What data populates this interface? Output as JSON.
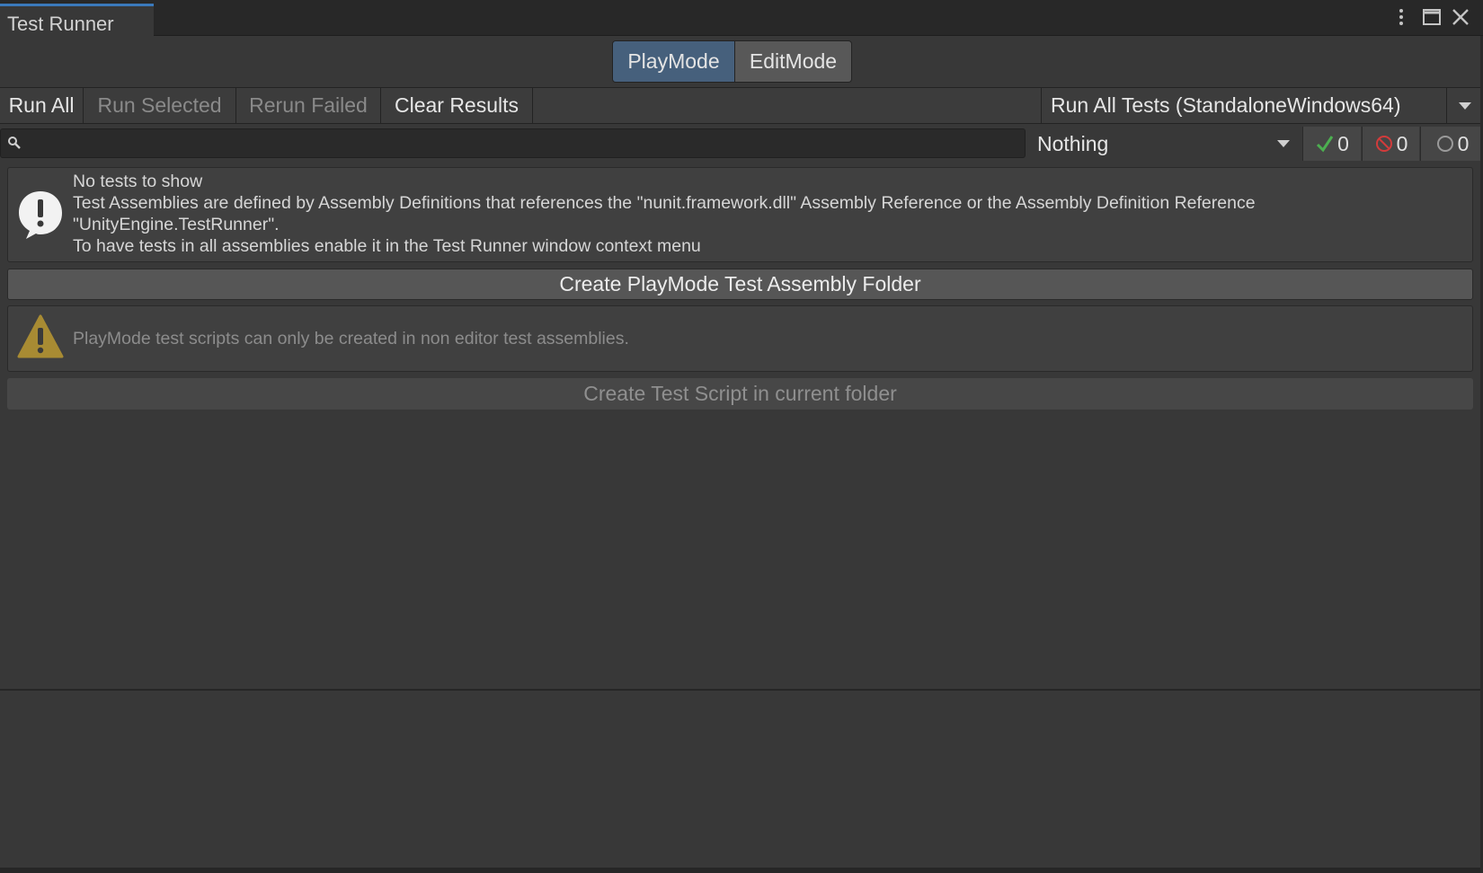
{
  "window": {
    "tab_title": "Test Runner"
  },
  "mode_toggle": {
    "playmode_label": "PlayMode",
    "editmode_label": "EditMode",
    "selected": "PlayMode"
  },
  "toolbar": {
    "run_all_label": "Run All",
    "run_selected_label": "Run Selected",
    "rerun_failed_label": "Rerun Failed",
    "clear_results_label": "Clear Results",
    "run_target_label": "Run All Tests (StandaloneWindows64)"
  },
  "filters": {
    "search_value": "",
    "category_value": "Nothing",
    "passed_count": "0",
    "failed_count": "0",
    "skipped_count": "0"
  },
  "info_box": {
    "title": "No tests to show",
    "line1": "Test Assemblies are defined by Assembly Definitions that references the \"nunit.framework.dll\" Assembly Reference or the Assembly Definition Reference",
    "line2": "\"UnityEngine.TestRunner\".",
    "line3": "To have tests in all assemblies enable it in the Test Runner window context menu"
  },
  "actions": {
    "create_assembly_label": "Create PlayMode Test Assembly Folder",
    "warning_text": "PlayMode test scripts can only be created in non editor test assemblies.",
    "create_script_label": "Create Test Script in current folder"
  },
  "colors": {
    "accent": "#3a79bb",
    "selected_mode": "#46607c",
    "passed": "#4caf50",
    "failed": "#d23b3b",
    "warning": "#c9a227"
  },
  "icons": {
    "menu": "kebab-icon",
    "maximize": "maximize-icon",
    "close": "close-icon",
    "search": "search-icon",
    "info": "info-icon",
    "warning": "warning-icon"
  }
}
